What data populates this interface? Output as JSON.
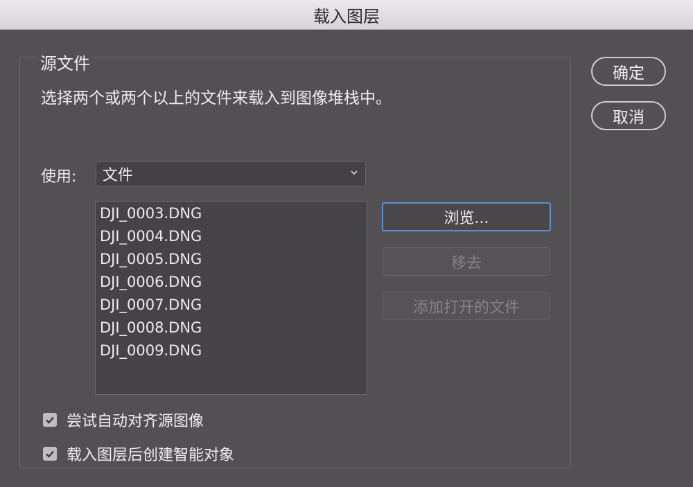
{
  "window": {
    "title": "载入图层"
  },
  "source_group": {
    "legend": "源文件",
    "description": "选择两个或两个以上的文件来载入到图像堆栈中。"
  },
  "use": {
    "label": "使用:",
    "selected": "文件"
  },
  "files": [
    "DJI_0003.DNG",
    "DJI_0004.DNG",
    "DJI_0005.DNG",
    "DJI_0006.DNG",
    "DJI_0007.DNG",
    "DJI_0008.DNG",
    "DJI_0009.DNG"
  ],
  "buttons": {
    "browse": "浏览...",
    "remove": "移去",
    "add_open": "添加打开的文件",
    "ok": "确定",
    "cancel": "取消"
  },
  "options": {
    "auto_align": {
      "label": "尝试自动对齐源图像",
      "checked": true
    },
    "smart_object": {
      "label": "载入图层后创建智能对象",
      "checked": true
    }
  },
  "colors": {
    "accent": "#5f8fcf",
    "background": "#535053"
  }
}
